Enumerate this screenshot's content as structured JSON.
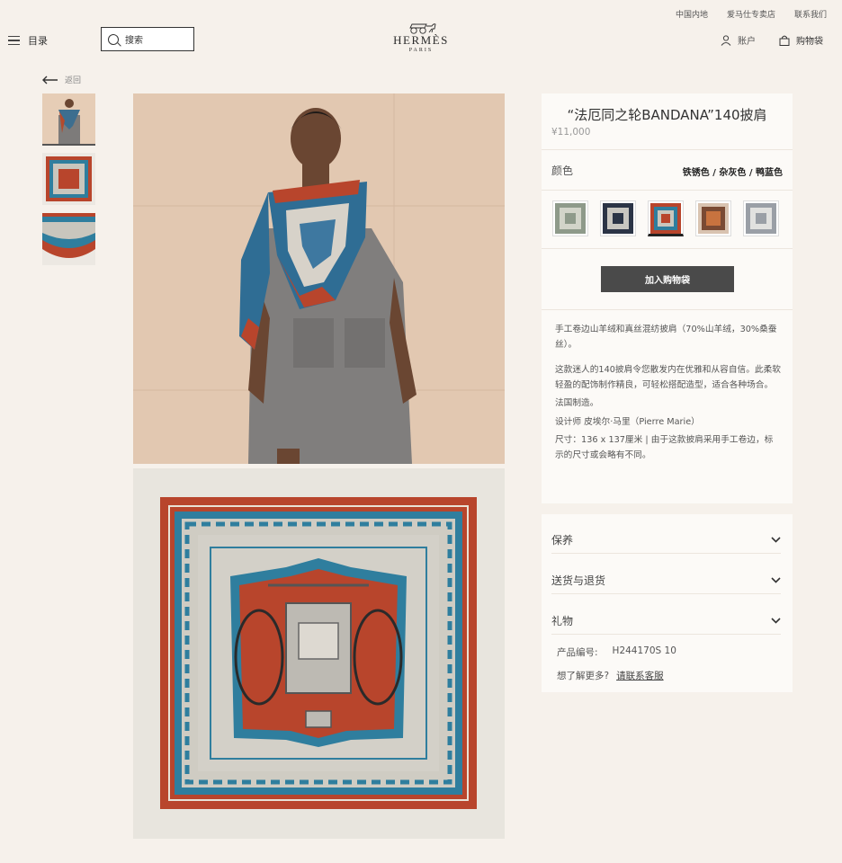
{
  "top_links": [
    "中国内地",
    "爱马仕专卖店",
    "联系我们"
  ],
  "header": {
    "menu_label": "目录",
    "search_label": "搜索",
    "brand": "HERMÈS",
    "city": "PARIS",
    "account_label": "账户",
    "cart_label": "购物袋"
  },
  "nav": {
    "back_label": "返回"
  },
  "product": {
    "title": "“法厄同之轮BANDANA”140披肩",
    "price": "¥11,000",
    "color_label": "颜色",
    "color_value": "铁锈色 / 杂灰色 / 鸭蓝色",
    "swatches": [
      {
        "name": "sage",
        "color": "#8e9a8a"
      },
      {
        "name": "navy",
        "color": "#2b3446"
      },
      {
        "name": "rust-teal",
        "color": "#b8452c"
      },
      {
        "name": "brown",
        "color": "#7a4a33"
      },
      {
        "name": "grey",
        "color": "#9a9fa6"
      }
    ],
    "add_to_cart": "加入购物袋",
    "description": [
      "手工卷边山羊绒和真丝混纺披肩（70%山羊绒，30%桑蚕丝）。",
      "这款迷人的140披肩令您散发内在优雅和从容自信。此柔软轻盈的配饰制作精良，可轻松搭配造型，适合各种场合。",
      "法国制造。",
      "设计师 皮埃尔·马里（Pierre Marie）",
      "尺寸：136 x 137厘米 | 由于这款披肩采用手工卷边，标示的尺寸或会略有不同。"
    ]
  },
  "accordion": {
    "items": [
      "保养",
      "送货与退货",
      "礼物"
    ],
    "product_code_label": "产品编号:",
    "product_code": "H244170S 10",
    "more_question": "想了解更多?",
    "contact_link": "请联系客服"
  },
  "colors": {
    "background": "#f6f1eb",
    "panel": "#fcfaf7",
    "button": "#4a4a4a",
    "rust": "#b8452c",
    "teal": "#2f7e9e"
  }
}
